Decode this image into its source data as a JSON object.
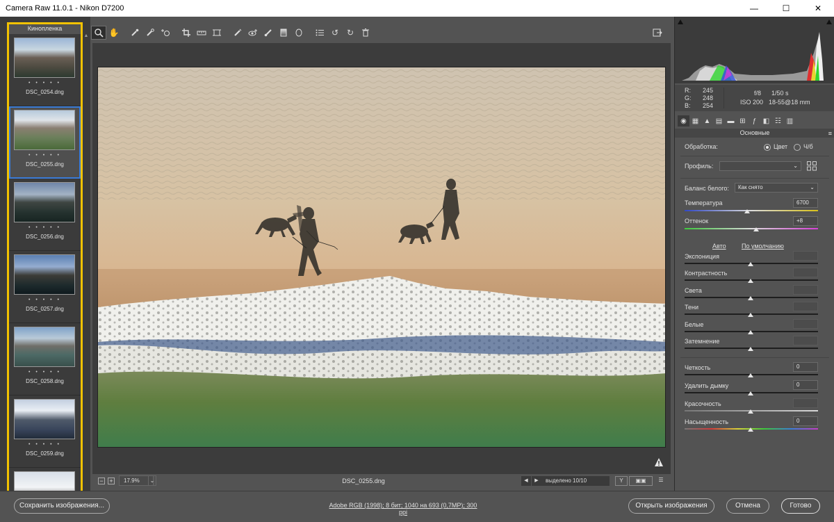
{
  "window": {
    "title": "Camera Raw 11.0.1  -  Nikon D7200",
    "minimize": "—",
    "maximize": "☐",
    "close": "✕"
  },
  "filmstrip": {
    "header": "Кинопленка",
    "thumbs": [
      {
        "name": "DSC_0254.dng",
        "rating": "• • • • •",
        "selected": false
      },
      {
        "name": "DSC_0255.dng",
        "rating": "• • • • •",
        "selected": true
      },
      {
        "name": "DSC_0256.dng",
        "rating": "• • • • •",
        "selected": false
      },
      {
        "name": "DSC_0257.dng",
        "rating": "• • • • •",
        "selected": false
      },
      {
        "name": "DSC_0258.dng",
        "rating": "• • • • •",
        "selected": false
      },
      {
        "name": "DSC_0259.dng",
        "rating": "• • • • •",
        "selected": false
      }
    ]
  },
  "toolbar": {
    "tools": [
      "zoom-icon",
      "hand-icon",
      "white-balance-icon",
      "color-sampler-icon",
      "targeted-adjustment-icon",
      "crop-icon",
      "straighten-icon",
      "transform-icon",
      "spot-removal-icon",
      "red-eye-icon",
      "adjustment-brush-icon",
      "graduated-filter-icon",
      "radial-filter-icon",
      "preferences-icon",
      "rotate-left-icon",
      "rotate-right-icon",
      "trash-icon"
    ],
    "active_tool": "zoom-icon"
  },
  "status": {
    "zoom_minus": "−",
    "zoom_plus": "+",
    "zoom": "17.9%",
    "filename": "DSC_0255.dng",
    "selected": "выделено 10/10",
    "view_toggle": "Y"
  },
  "info": {
    "r_label": "R:",
    "g_label": "G:",
    "b_label": "B:",
    "r": "245",
    "g": "248",
    "b": "254",
    "aperture": "f/8",
    "shutter": "1/50 s",
    "iso": "ISO 200",
    "lens": "18-55@18 mm"
  },
  "panel": {
    "title": "Основные",
    "menu_icon": "≡",
    "processing_label": "Обработка:",
    "color_label": "Цвет",
    "bw_label": "Ч/б",
    "profile_label": "Профиль:",
    "profile_value": "",
    "wb_label": "Баланс белого:",
    "wb_value": "Как снято",
    "temp_label": "Температура",
    "temp_value": "6700",
    "tint_label": "Оттенок",
    "tint_value": "+8",
    "auto_link": "Авто",
    "default_link": "По умолчанию",
    "sliders": [
      {
        "label": "Экспониция",
        "value": ""
      },
      {
        "label": "Контрастность",
        "value": ""
      },
      {
        "label": "Света",
        "value": ""
      },
      {
        "label": "Тени",
        "value": ""
      },
      {
        "label": "Белые",
        "value": ""
      },
      {
        "label": "Затемнение",
        "value": ""
      }
    ],
    "presence": [
      {
        "label": "Четкость",
        "value": "0"
      },
      {
        "label": "Удалить дымку",
        "value": "0"
      },
      {
        "label": "Красочность",
        "value": ""
      },
      {
        "label": "Насыщенность",
        "value": "0"
      }
    ]
  },
  "bottom": {
    "save": "Сохранить изображения...",
    "workflow": "Adobe RGB (1998); 8 бит; 1040 на 693 (0,7MP); 300 ppi",
    "open": "Открыть изображения",
    "cancel": "Отмена",
    "done": "Готово"
  },
  "colors": {
    "highlight": "#f2c200",
    "selection": "#3a7bd5"
  }
}
